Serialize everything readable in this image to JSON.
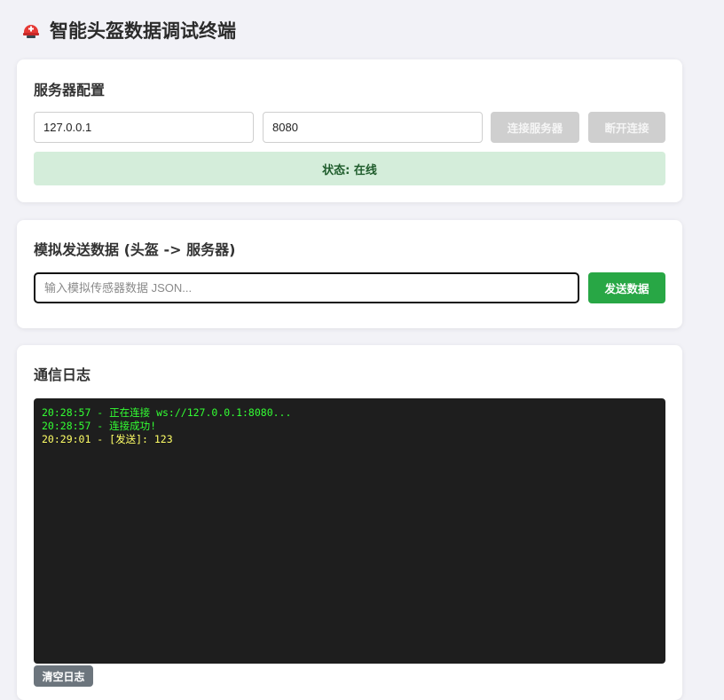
{
  "app": {
    "title": "智能头盔数据调试终端"
  },
  "server_config": {
    "heading": "服务器配置",
    "ip_value": "127.0.0.1",
    "port_value": "8080",
    "connect_label": "连接服务器",
    "disconnect_label": "断开连接",
    "status_text": "状态: 在线"
  },
  "send": {
    "heading": "模拟发送数据 (头盔 -> 服务器)",
    "input_placeholder": "输入模拟传感器数据 JSON...",
    "input_value": "",
    "send_label": "发送数据"
  },
  "log": {
    "heading": "通信日志",
    "lines": [
      {
        "text": "20:28:57 - 正在连接 ws://127.0.0.1:8080...",
        "color": "#33ff33"
      },
      {
        "text": "20:28:57 - 连接成功!",
        "color": "#33ff33"
      },
      {
        "text": "20:29:01 - [发送]: 123",
        "color": "#ffff66"
      }
    ],
    "clear_label": "清空日志"
  },
  "icons": {
    "title_icon": "helmet-icon"
  },
  "colors": {
    "status_bg": "#d4edda",
    "send_button": "#28a745",
    "disabled_button": "#cfcfcf",
    "log_bg": "#1e1e1e"
  }
}
